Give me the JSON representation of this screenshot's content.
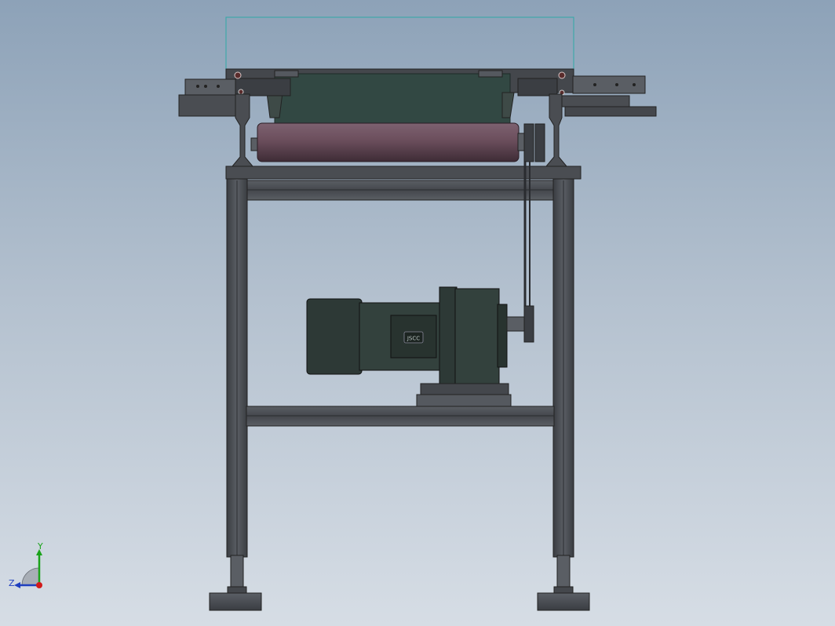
{
  "viewport": {
    "background_top": "#8da2b8",
    "background_bottom": "#d6dde5"
  },
  "model": {
    "motor_nameplate": "JSCC",
    "colors": {
      "frame": "#4a4d52",
      "frame_dark": "#2e3135",
      "belt": "#324843",
      "roller": "#6b4e5c",
      "motor": "#2d3936",
      "bounding_box": "#2fa9a6"
    }
  },
  "triad": {
    "y_label": "Y",
    "z_label": "Z",
    "y_color": "#1aa31a",
    "z_color": "#1f3fbf",
    "origin_color": "#d11a1a"
  }
}
